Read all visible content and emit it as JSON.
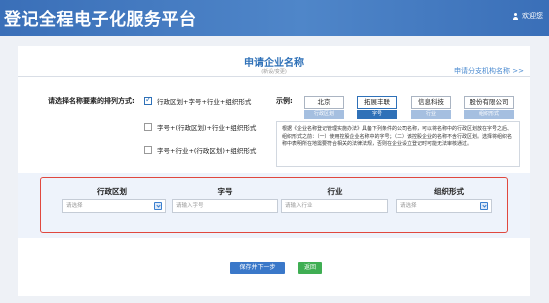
{
  "header": {
    "title": "登记全程电子化服务平台",
    "welcome": "欢迎您"
  },
  "apply": {
    "title": "申请企业名称",
    "subtitle": "(新设/变更)",
    "branch_link": "申请分支机构名称 >>"
  },
  "arrangement": {
    "label": "请选择名称要素的排列方式:",
    "options": [
      {
        "label": "行政区划+字号+行业+组织形式",
        "checked": true
      },
      {
        "label": "字号+(行政区划)+行业+组织形式",
        "checked": false
      },
      {
        "label": "字号+行业+(行政区划)+组织形式",
        "checked": false
      }
    ]
  },
  "example": {
    "label": "示例:",
    "items": [
      {
        "text": "北京",
        "caption": "行政区划",
        "active": false
      },
      {
        "text": "拓展丰联",
        "caption": "字号",
        "active": true
      },
      {
        "text": "信息科技",
        "caption": "行业",
        "active": false
      },
      {
        "text": "股份有限公司",
        "caption": "组织形式",
        "active": false
      }
    ],
    "explanation": "根据《企业名称登记管理实施办法》具备下列条件的公司名称，可以将名称中的行政区划放在字号之后、组织形式之前：（一）使用控股企业名称中的字号；（二）该控股企业的名称不含行政区划。选择将组织名称中表明所在地需要符合相关的法律法规，否则在企业设立登记时可能无法审核通过。"
  },
  "fields": [
    {
      "title": "行政区划",
      "placeholder": "请选择",
      "has_dropdown": true
    },
    {
      "title": "字号",
      "placeholder": "请输入字号",
      "has_dropdown": false
    },
    {
      "title": "行业",
      "placeholder": "请输入行业",
      "has_dropdown": false
    },
    {
      "title": "组织形式",
      "placeholder": "请选择",
      "has_dropdown": true
    }
  ],
  "buttons": {
    "save_next": "保存并下一步",
    "back": "返回"
  },
  "colors": {
    "header_blue": "#3a6fb8",
    "accent_blue": "#2f71b8",
    "highlight_red": "#e0483e",
    "back_green": "#3fae53"
  }
}
